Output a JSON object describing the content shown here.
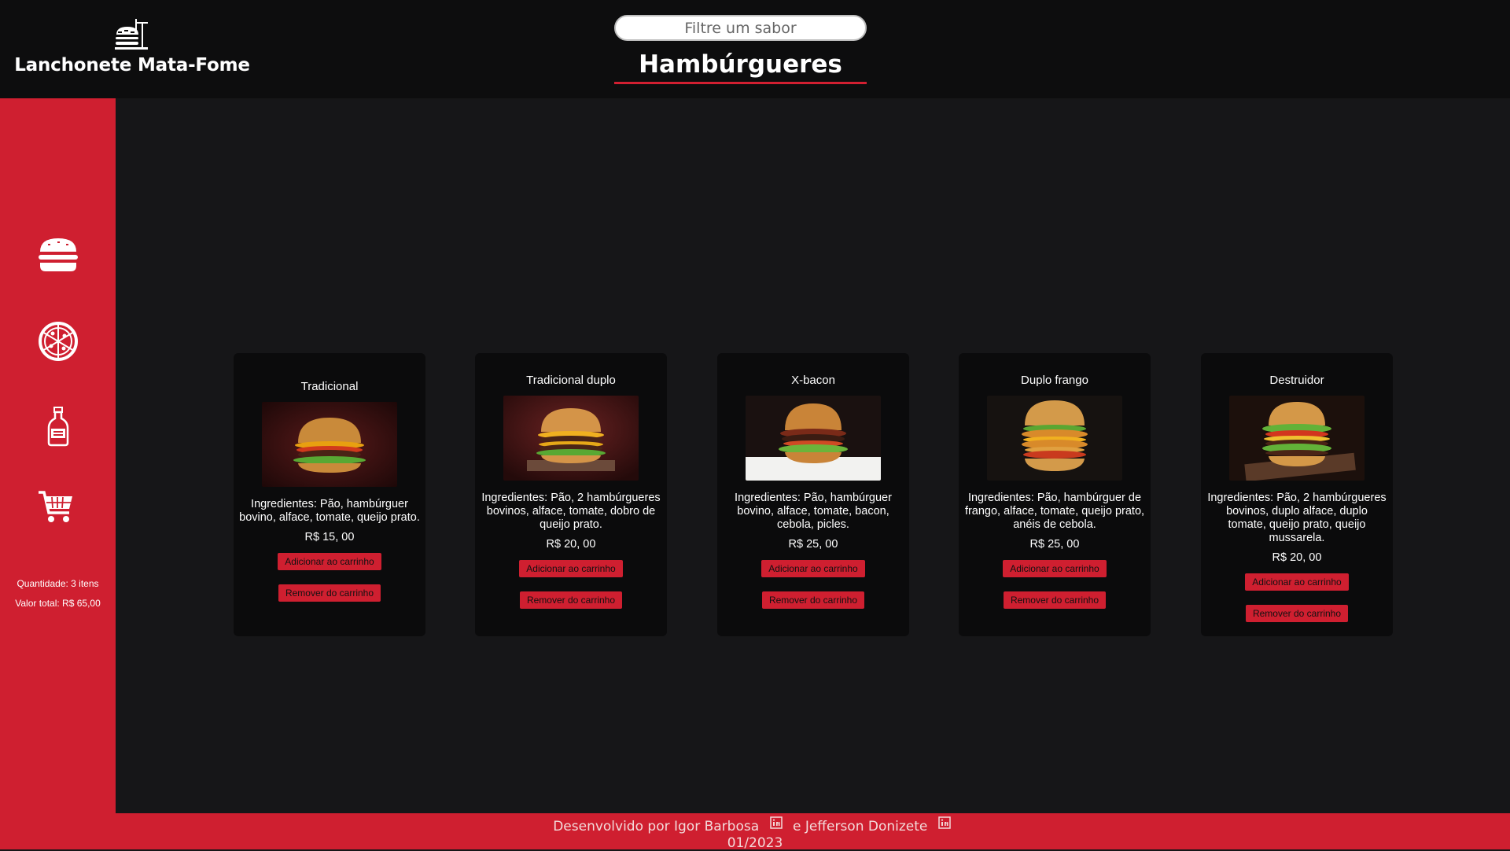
{
  "app": {
    "brand": "Lanchonete Mata-Fome",
    "search_placeholder": "Filtre um sabor",
    "section_title": "Hambúrgueres"
  },
  "sidebar": {
    "items": [
      {
        "icon": "hamburger-icon"
      },
      {
        "icon": "pizza-icon"
      },
      {
        "icon": "bottle-icon"
      },
      {
        "icon": "cart-icon"
      }
    ],
    "quantity": "Quantidade: 3 itens",
    "total": "Valor total: R$ 65,00"
  },
  "products": [
    {
      "name": "Tradicional",
      "ingredients": "Ingredientes: Pão, hambúrguer bovino, alface, tomate, queijo prato.",
      "price": "R$ 15, 00",
      "add_label": "Adicionar ao carrinho",
      "remove_label": "Remover do carrinho"
    },
    {
      "name": "Tradicional duplo",
      "ingredients": "Ingredientes: Pão, 2 hambúrgueres bovinos, alface, tomate, dobro de queijo prato.",
      "price": "R$ 20, 00",
      "add_label": "Adicionar ao carrinho",
      "remove_label": "Remover do carrinho"
    },
    {
      "name": "X-bacon",
      "ingredients": "Ingredientes: Pão, hambúrguer bovino, alface, tomate, bacon, cebola, picles.",
      "price": "R$ 25, 00",
      "add_label": "Adicionar ao carrinho",
      "remove_label": "Remover do carrinho"
    },
    {
      "name": "Duplo frango",
      "ingredients": "Ingredientes: Pão, hambúrguer de frango, alface, tomate, queijo prato, anéis de cebola.",
      "price": "R$ 25, 00",
      "add_label": "Adicionar ao carrinho",
      "remove_label": "Remover do carrinho"
    },
    {
      "name": "Destruidor",
      "ingredients": "Ingredientes: Pão, 2 hambúrgueres bovinos, duplo alface, duplo tomate, queijo prato, queijo mussarela.",
      "price": "R$ 20, 00",
      "add_label": "Adicionar ao carrinho",
      "remove_label": "Remover do carrinho"
    }
  ],
  "footer": {
    "prefix": "Desenvolvido por Igor Barbosa",
    "connector": "e Jefferson Donizete",
    "date": "01/2023",
    "icon": "linkedin-icon"
  },
  "colors": {
    "accent": "#cf1f30",
    "header_bg": "#0d0d0e",
    "page_bg": "#161618",
    "card_bg": "#0b0b0c"
  }
}
